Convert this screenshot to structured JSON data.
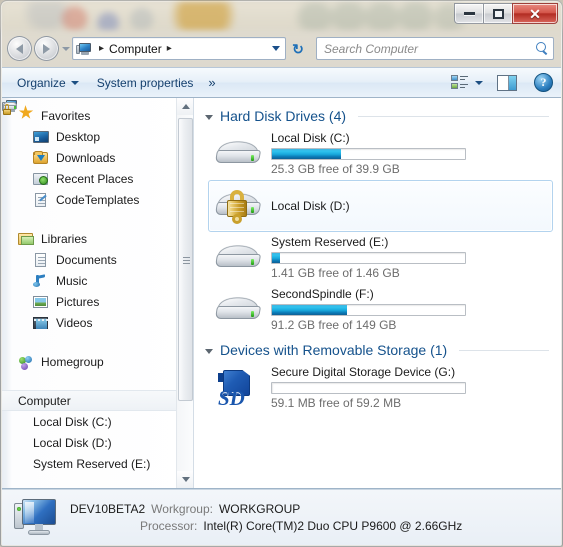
{
  "window": {
    "buttons": {
      "minimize": "Minimize",
      "maximize": "Maximize",
      "close": "✕"
    }
  },
  "address_bar": {
    "back_label": "Back",
    "forward_label": "Forward",
    "history_label": "Recent pages",
    "crumb_icon": "computer-icon",
    "crumb_label": "Computer",
    "separator": "▸",
    "refresh_glyph": "↻",
    "search_placeholder": "Search Computer",
    "search_value": ""
  },
  "command_bar": {
    "organize_label": "Organize",
    "system_properties_label": "System properties",
    "overflow_label": "»",
    "view_label": "Change your view",
    "preview_pane_label": "Show the preview pane",
    "help_label": "?"
  },
  "sidebar": {
    "groups": [
      {
        "name": "Favorites",
        "icon": "star-icon",
        "items": [
          {
            "label": "Desktop",
            "icon": "desktop-icon"
          },
          {
            "label": "Downloads",
            "icon": "downloads-folder-icon"
          },
          {
            "label": "Recent Places",
            "icon": "recent-places-icon"
          },
          {
            "label": "CodeTemplates",
            "icon": "document-shortcut-icon"
          }
        ]
      },
      {
        "name": "Libraries",
        "icon": "libraries-icon",
        "items": [
          {
            "label": "Documents",
            "icon": "documents-icon"
          },
          {
            "label": "Music",
            "icon": "music-icon"
          },
          {
            "label": "Pictures",
            "icon": "pictures-icon"
          },
          {
            "label": "Videos",
            "icon": "videos-icon"
          }
        ]
      },
      {
        "name": "Homegroup",
        "icon": "homegroup-icon",
        "items": []
      },
      {
        "name": "Computer",
        "icon": "computer-icon",
        "selected": true,
        "items": [
          {
            "label": "Local Disk (C:)",
            "icon": "drive-icon"
          },
          {
            "label": "Local Disk (D:)",
            "icon": "drive-locked-icon"
          },
          {
            "label": "System Reserved (E:)",
            "icon": "drive-icon"
          }
        ]
      }
    ]
  },
  "content": {
    "sections": [
      {
        "title": "Hard Disk Drives (4)",
        "drives": [
          {
            "name": "Local Disk (C:)",
            "icon": "hard-disk-icon",
            "has_bar": true,
            "used_percent": 36,
            "free_text": "25.3 GB free of 39.9 GB"
          },
          {
            "name": "Local Disk (D:)",
            "icon": "hard-disk-locked-icon",
            "has_bar": false,
            "used_percent": 0,
            "free_text": "",
            "hovered": true
          },
          {
            "name": "System Reserved (E:)",
            "icon": "hard-disk-icon",
            "has_bar": true,
            "used_percent": 4,
            "free_text": "1.41 GB free of 1.46 GB"
          },
          {
            "name": "SecondSpindle (F:)",
            "icon": "hard-disk-icon",
            "has_bar": true,
            "used_percent": 39,
            "free_text": "91.2 GB free of 149 GB"
          }
        ]
      },
      {
        "title": "Devices with Removable Storage (1)",
        "drives": [
          {
            "name": "Secure Digital Storage Device (G:)",
            "icon": "sd-card-icon",
            "has_bar": true,
            "used_percent": 0,
            "free_text": "59.1 MB free of 59.2 MB"
          }
        ]
      }
    ]
  },
  "status_bar": {
    "icon": "computer-icon",
    "computer_name": "DEV10BETA2",
    "workgroup_label": "Workgroup:",
    "workgroup_value": "WORKGROUP",
    "processor_label": "Processor:",
    "processor_value": "Intel(R) Core(TM)2 Duo CPU    P9600  @ 2.66GHz"
  },
  "colors": {
    "accent_blue": "#15528c",
    "bar_fill": "#19a9dd",
    "close_red": "#d4564b",
    "selection_border": "#b3d3ee"
  }
}
